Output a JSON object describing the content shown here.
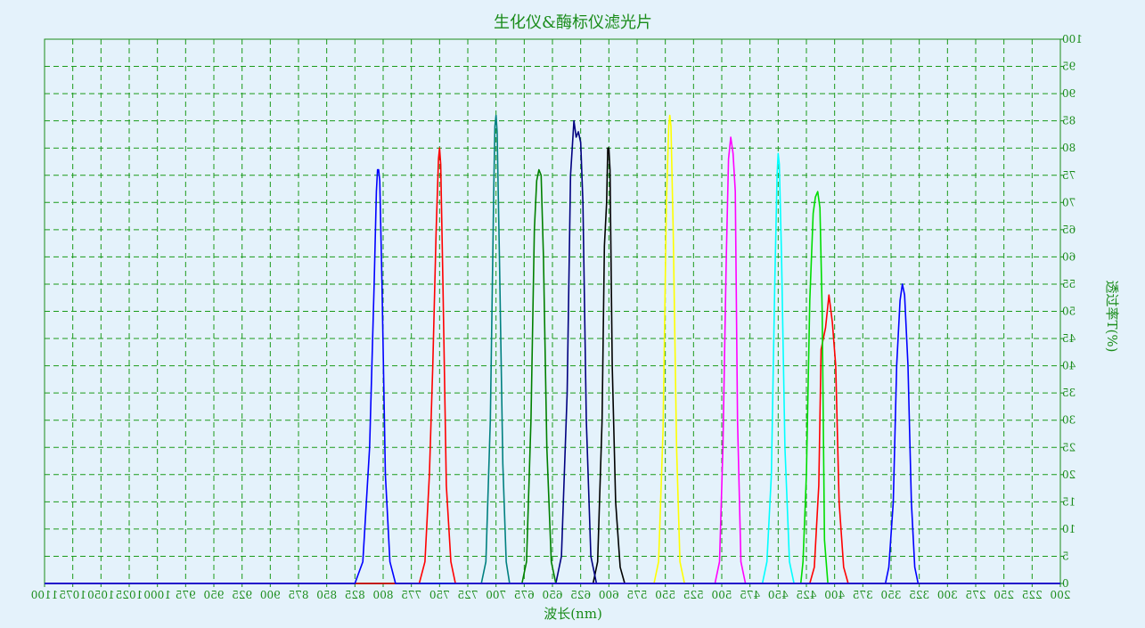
{
  "chart_data": {
    "type": "line",
    "title": "生化仪&酶标仪滤光片",
    "xlabel": "波长(nm)",
    "ylabel": "透过率T(%)",
    "x_reversed": true,
    "xlim": [
      200,
      1100
    ],
    "ylim": [
      0,
      100
    ],
    "x_ticks": [
      200,
      225,
      250,
      275,
      300,
      325,
      350,
      375,
      400,
      425,
      450,
      475,
      500,
      525,
      550,
      575,
      600,
      625,
      650,
      675,
      700,
      725,
      750,
      775,
      800,
      825,
      850,
      875,
      900,
      925,
      950,
      975,
      1000,
      1025,
      1050,
      1075,
      1100
    ],
    "x_tick_labels": [
      "200",
      "225",
      "250",
      "275",
      "300",
      "325",
      "350",
      "375",
      "400",
      "425",
      "450",
      "475",
      "500",
      "525",
      "550",
      "575",
      "600",
      "625",
      "650",
      "675",
      "700",
      "725",
      "750",
      "775",
      "800",
      "825",
      "850",
      "875",
      "900",
      "925",
      "950",
      "975",
      "1000",
      "1025",
      "1050",
      "1075",
      "1100"
    ],
    "y_ticks": [
      0,
      5,
      10,
      15,
      20,
      25,
      30,
      35,
      40,
      45,
      50,
      55,
      60,
      65,
      70,
      75,
      80,
      85,
      90,
      95,
      100
    ],
    "y_tick_labels": [
      "0",
      "5",
      "10",
      "15",
      "20",
      "25",
      "30",
      "35",
      "40",
      "45",
      "50",
      "55",
      "60",
      "65",
      "70",
      "75",
      "80",
      "85",
      "90",
      "95",
      "100"
    ],
    "grid": true,
    "colors": {
      "background": "#e4f2fb",
      "axis": "#1a8c1a",
      "grid": "#1a9a1a",
      "text": "#1a8c1a"
    },
    "series": [
      {
        "color": "#0000ff",
        "peak_nm": 340,
        "peak_t": 55,
        "x": [
          355,
          352,
          348,
          345,
          342,
          340,
          338,
          335,
          332,
          329,
          326
        ],
        "y": [
          0,
          3,
          15,
          40,
          52,
          55,
          53,
          40,
          15,
          3,
          0
        ]
      },
      {
        "color": "#ff0000",
        "peak_nm": 405,
        "peak_t": 53,
        "x": [
          422,
          418,
          414,
          412,
          410,
          408,
          405,
          402,
          399,
          396,
          392,
          388
        ],
        "y": [
          0,
          3,
          18,
          43,
          45,
          47,
          53,
          48,
          40,
          15,
          3,
          0
        ]
      },
      {
        "color": "#00dd00",
        "peak_nm": 415,
        "peak_t": 72,
        "x": [
          430,
          428,
          425,
          422,
          419,
          417,
          415,
          413,
          411,
          409,
          406
        ],
        "y": [
          0,
          4,
          20,
          52,
          68,
          71,
          72,
          69,
          50,
          8,
          0
        ]
      },
      {
        "color": "#00ffff",
        "peak_nm": 450,
        "peak_t": 79,
        "x": [
          464,
          460,
          456,
          453,
          451,
          450,
          449,
          447,
          444,
          440,
          436
        ],
        "y": [
          0,
          4,
          20,
          55,
          75,
          79,
          77,
          60,
          25,
          4,
          0
        ]
      },
      {
        "color": "#ff00ff",
        "peak_nm": 492,
        "peak_t": 82,
        "x": [
          506,
          502,
          499,
          496,
          494,
          492,
          490,
          488,
          486,
          483,
          479
        ],
        "y": [
          0,
          4,
          25,
          60,
          78,
          82,
          79,
          72,
          30,
          4,
          0
        ]
      },
      {
        "color": "#ffff00",
        "peak_nm": 546,
        "peak_t": 86,
        "x": [
          560,
          556,
          552,
          549,
          547,
          546,
          545,
          543,
          540,
          537,
          533
        ],
        "y": [
          0,
          4,
          28,
          70,
          84,
          86,
          84,
          65,
          25,
          4,
          0
        ]
      },
      {
        "color": "#000000",
        "peak_nm": 600,
        "peak_t": 80,
        "x": [
          614,
          610,
          606,
          604,
          602,
          601,
          600,
          599,
          597,
          594,
          590,
          586
        ],
        "y": [
          0,
          4,
          30,
          62,
          70,
          80,
          80,
          76,
          40,
          15,
          3,
          0
        ]
      },
      {
        "color": "#000080",
        "peak_nm": 630,
        "peak_t": 86,
        "x": [
          647,
          642,
          637,
          634,
          631,
          629,
          627,
          625,
          623,
          620,
          616,
          611
        ],
        "y": [
          0,
          5,
          35,
          75,
          85,
          82,
          83,
          81,
          70,
          30,
          5,
          0
        ]
      },
      {
        "color": "#008000",
        "peak_nm": 662,
        "peak_t": 76,
        "x": [
          677,
          673,
          669,
          666,
          664,
          662,
          660,
          658,
          655,
          651,
          647
        ],
        "y": [
          0,
          4,
          30,
          65,
          74,
          76,
          75,
          60,
          25,
          4,
          0
        ]
      },
      {
        "color": "#008080",
        "peak_nm": 700,
        "peak_t": 86,
        "x": [
          713,
          709,
          705,
          702,
          701,
          700,
          699,
          697,
          694,
          691,
          688
        ],
        "y": [
          0,
          4,
          30,
          72,
          84,
          86,
          83,
          60,
          22,
          4,
          0
        ]
      },
      {
        "color": "#ff0000",
        "peak_nm": 750,
        "peak_t": 80,
        "x": [
          768,
          763,
          759,
          756,
          753,
          751,
          750,
          749,
          747,
          744,
          740,
          736
        ],
        "y": [
          0,
          4,
          20,
          40,
          65,
          78,
          80,
          77,
          55,
          18,
          4,
          0
        ]
      },
      {
        "color": "#0000ff",
        "peak_nm": 805,
        "peak_t": 76,
        "x": [
          825,
          818,
          812,
          808,
          806,
          805,
          804,
          803,
          801,
          798,
          794,
          789
        ],
        "y": [
          0,
          4,
          25,
          55,
          72,
          76,
          76,
          74,
          55,
          20,
          4,
          0
        ]
      }
    ]
  }
}
